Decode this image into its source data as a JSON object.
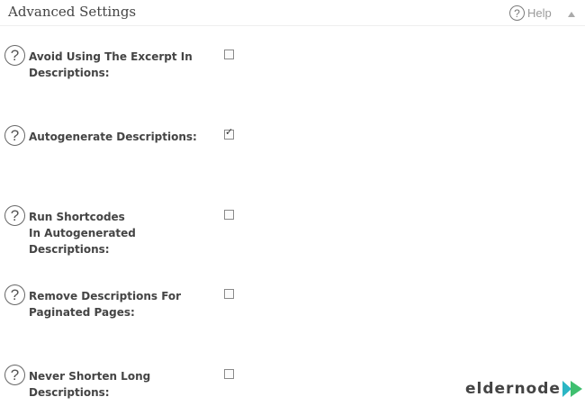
{
  "panel": {
    "title": "Advanced Settings",
    "help_label": "Help"
  },
  "options": [
    {
      "label": "Avoid Using The Excerpt In Descriptions:",
      "checked": false
    },
    {
      "label": "Autogenerate Descriptions:",
      "checked": true
    },
    {
      "label": "Run Shortcodes In Autogenerated Descriptions:",
      "checked": false
    },
    {
      "label": "Remove Descriptions For Paginated Pages:",
      "checked": false
    },
    {
      "label": "Never Shorten Long Descriptions:",
      "checked": false
    }
  ],
  "watermark": {
    "text": "eldernode"
  },
  "colors": {
    "logo_teal": "#2bb6c4",
    "logo_green": "#3fbf6f"
  }
}
